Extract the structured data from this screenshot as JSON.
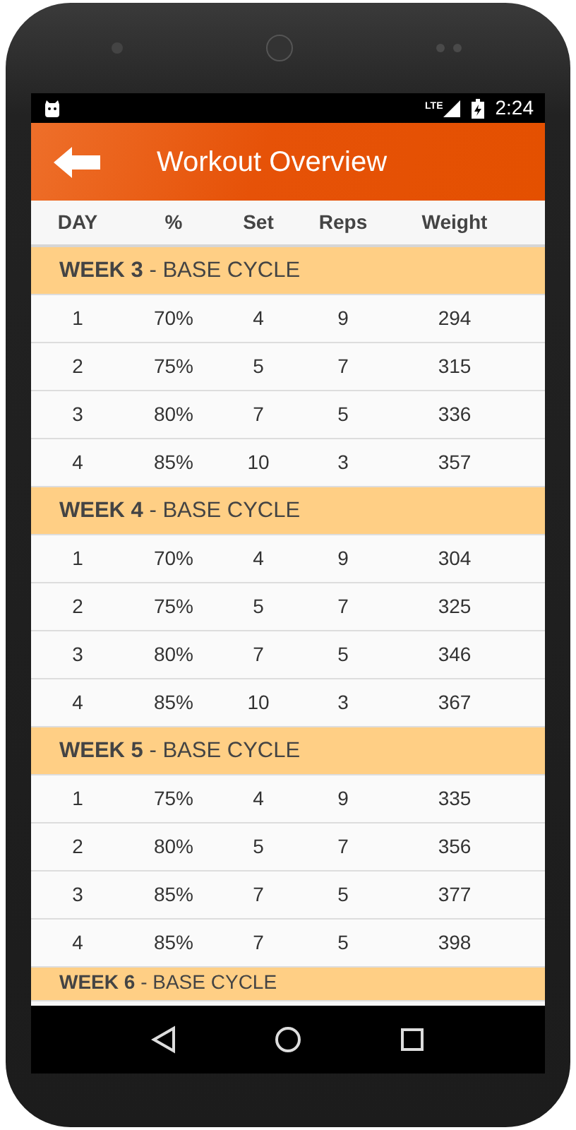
{
  "status_bar": {
    "network": "LTE",
    "time": "2:24"
  },
  "app_bar": {
    "title": "Workout Overview"
  },
  "table": {
    "columns": [
      "DAY",
      "%",
      "Set",
      "Reps",
      "Weight"
    ],
    "weeks": [
      {
        "title": "**WEEK 3** - BASE CYCLE",
        "rows": [
          [
            "1",
            "70%",
            "4",
            "9",
            "294"
          ],
          [
            "2",
            "75%",
            "5",
            "7",
            "315"
          ],
          [
            "3",
            "80%",
            "7",
            "5",
            "336"
          ],
          [
            "4",
            "85%",
            "10",
            "3",
            "357"
          ]
        ]
      },
      {
        "title": "**WEEK 4** - BASE CYCLE",
        "rows": [
          [
            "1",
            "70%",
            "4",
            "9",
            "304"
          ],
          [
            "2",
            "75%",
            "5",
            "7",
            "325"
          ],
          [
            "3",
            "80%",
            "7",
            "5",
            "346"
          ],
          [
            "4",
            "85%",
            "10",
            "3",
            "367"
          ]
        ]
      },
      {
        "title": "**WEEK 5** - BASE CYCLE",
        "rows": [
          [
            "1",
            "75%",
            "4",
            "9",
            "335"
          ],
          [
            "2",
            "80%",
            "5",
            "7",
            "356"
          ],
          [
            "3",
            "85%",
            "7",
            "5",
            "377"
          ],
          [
            "4",
            "85%",
            "7",
            "5",
            "398"
          ]
        ]
      },
      {
        "title": "**WEEK 6** - BASE CYCLE"
      }
    ]
  }
}
